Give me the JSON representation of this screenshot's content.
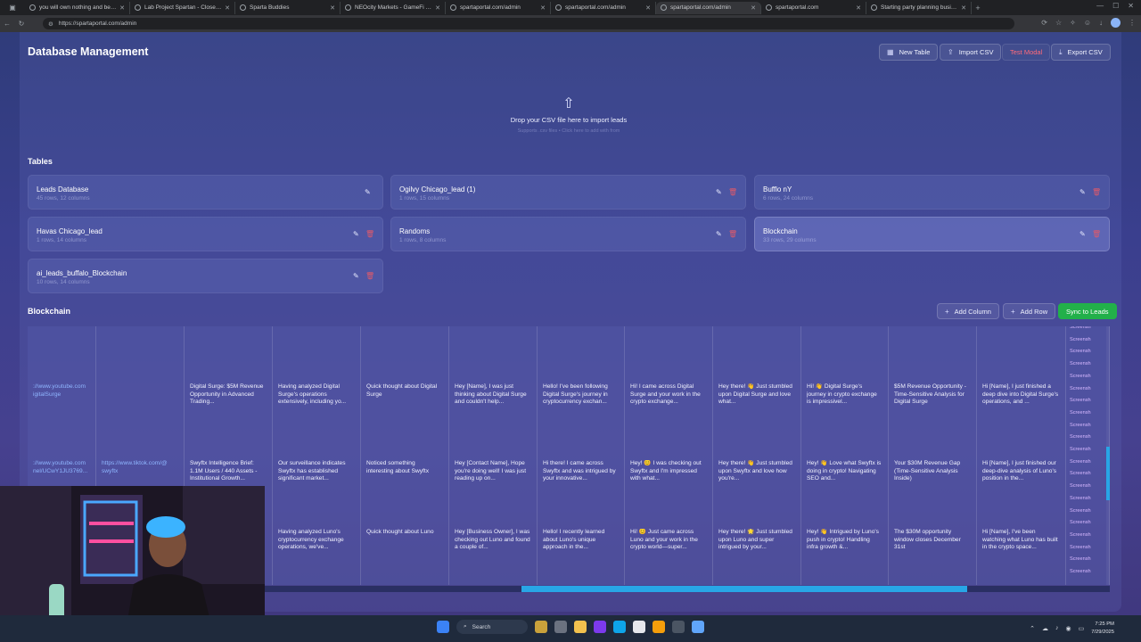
{
  "browser": {
    "tabs": [
      {
        "title": "you will own nothing and be happy",
        "active": false
      },
      {
        "title": "Lab Project Spartan - Close 5-Figure",
        "active": false
      },
      {
        "title": "Sparta Buddies",
        "active": false
      },
      {
        "title": "NEOcity Markets - GameFi Lead Gen",
        "active": false
      },
      {
        "title": "spartaportal.com/admin",
        "active": false
      },
      {
        "title": "spartaportal.com/admin",
        "active": false
      },
      {
        "title": "spartaportal.com/admin",
        "active": true
      },
      {
        "title": "spartaportal.com",
        "active": false
      },
      {
        "title": "Starting party planning business",
        "active": false
      }
    ],
    "url": "https://spartaportal.com/admin"
  },
  "header": {
    "title": "Database Management",
    "buttons": {
      "new_table": "New Table",
      "import_csv": "Import CSV",
      "test_modal": "Test Modal",
      "export_csv": "Export CSV"
    }
  },
  "dropzone": {
    "title": "Drop your CSV file here to import leads",
    "subtitle": "Supports .csv files • Click here to add with from"
  },
  "tables_section": {
    "title": "Tables",
    "tables": [
      {
        "name": "Leads Database",
        "meta": "45 rows, 12 columns",
        "deletable": false,
        "selected": false
      },
      {
        "name": "Ogilvy Chicago_lead (1)",
        "meta": "1 rows, 15 columns",
        "deletable": true,
        "selected": false
      },
      {
        "name": "Bufflo nY",
        "meta": "6 rows, 24 columns",
        "deletable": true,
        "selected": false
      },
      {
        "name": "Havas Chicago_lead",
        "meta": "1 rows, 14 columns",
        "deletable": true,
        "selected": false
      },
      {
        "name": "Randoms",
        "meta": "1 rows, 8 columns",
        "deletable": true,
        "selected": false
      },
      {
        "name": "Blockchain",
        "meta": "33 rows, 29 columns",
        "deletable": true,
        "selected": true
      },
      {
        "name": "ai_leads_buffalo_Blockchain",
        "meta": "10 rows, 14 columns",
        "deletable": true,
        "selected": false
      }
    ]
  },
  "data_section": {
    "title": "Blockchain",
    "buttons": {
      "add_column": "Add Column",
      "add_row": "Add Row",
      "sync": "Sync to Leads"
    },
    "rows": [
      [
        "://www.youtube.com\nigitalSurge",
        "",
        "Digital Surge: $5M Revenue Opportunity in Advanced Trading...",
        "Having analyzed Digital Surge's operations extensively, including yo...",
        "Quick thought about Digital Surge",
        "Hey [Name], I was just thinking about Digital Surge and couldn't help...",
        "Hello! I've been following Digital Surge's journey in cryptocurrency exchan...",
        "Hi! I came across Digital Surge and your work in the crypto exchange...",
        "Hey there! 👋 Just stumbled upon Digital Surge and love what...",
        "Hi! 👋 Digital Surge's journey in crypto exchange is impressivel...",
        "$5M Revenue Opportunity - Time-Sensitive Analysis for Digital Surge",
        "Hi [Name], I just finished a deep dive into Digital Surge's operations, and ..."
      ],
      [
        "://www.youtube.com\nnel/UCwY1JU3769...",
        "https://www.tiktok.com/@\nswyftx",
        "Swyftx Intelligence Brief: 1.1M Users / 440 Assets - Institutional Growth...",
        "Our surveillance indicates Swyftx has established significant market...",
        "Noticed something interesting about Swyftx",
        "Hey [Contact Name], Hope you're doing well! I was just reading up on...",
        "Hi there! I came across Swyftx and was intrigued by your innovative...",
        "Hey! 😊 I was checking out Swyftx and I'm impressed with what...",
        "Hey there! 👋 Just stumbled upon Swyftx and love how you're...",
        "Hey! 👋 Love what Swyftx is doing in crypto! Navigating SEO and...",
        "Your $30M Revenue Gap (Time-Sensitive Analysis Inside)",
        "Hi [Name], I just finished our deep-dive analysis of Luno's position in the..."
      ],
      [
        "",
        "",
        "",
        "Having analyzed Luno's cryptocurrency exchange operations, we've...",
        "Quick thought about Luno",
        "Hey [Business Owner], I was checking out Luno and found a couple of...",
        "Hello! I recently learned about Luno's unique approach in the...",
        "Hi! 😊 Just came across Luno and your work in the crypto world—super...",
        "Hey there! 🌟 Just stumbled upon Luno and super intrigued by your...",
        "Hey! 👋 Intrigued by Luno's push in crypto! Handling infra growth &...",
        "The $30M opportunity window closes December 31st",
        "Hi [Name], I've been watching what Luno has built in the crypto space..."
      ]
    ],
    "last_column_item": "Screensh"
  },
  "taskbar": {
    "search_placeholder": "Search",
    "time": "7:25 PM",
    "date": "7/29/2025"
  }
}
